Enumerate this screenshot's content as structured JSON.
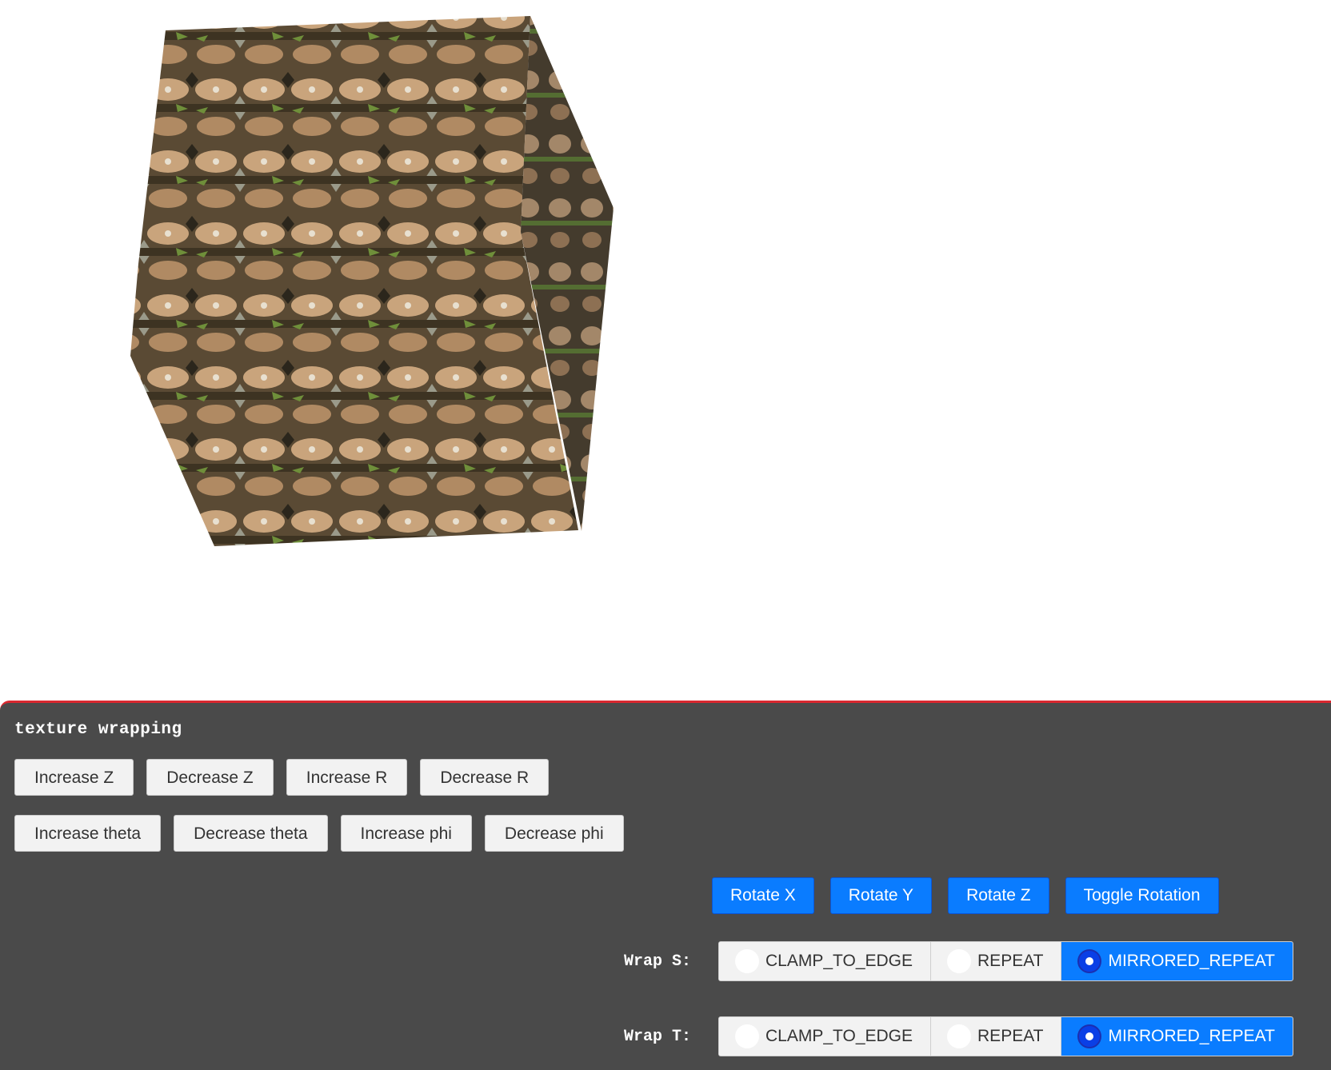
{
  "panel": {
    "title": "texture wrapping"
  },
  "camera_buttons": {
    "row1": [
      "Increase Z",
      "Decrease Z",
      "Increase R",
      "Decrease R"
    ],
    "row2": [
      "Increase theta",
      "Decrease theta",
      "Increase phi",
      "Decrease phi"
    ]
  },
  "rotation_buttons": [
    "Rotate X",
    "Rotate Y",
    "Rotate Z",
    "Toggle Rotation"
  ],
  "wrap_s": {
    "label": "Wrap S:",
    "options": [
      "CLAMP_TO_EDGE",
      "REPEAT",
      "MIRRORED_REPEAT"
    ],
    "selected": "MIRRORED_REPEAT"
  },
  "wrap_t": {
    "label": "Wrap T:",
    "options": [
      "CLAMP_TO_EDGE",
      "REPEAT",
      "MIRRORED_REPEAT"
    ],
    "selected": "MIRRORED_REPEAT"
  },
  "colors": {
    "panel_bg": "#4a4a4a",
    "panel_border": "#d9282f",
    "accent_blue": "#0a7cff",
    "button_gray": "#f2f2f2"
  }
}
